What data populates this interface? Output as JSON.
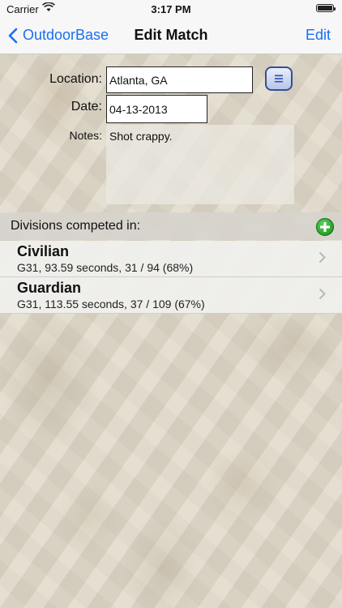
{
  "status": {
    "carrier": "Carrier",
    "time": "3:17 PM",
    "wifi_icon": "wifi-icon",
    "battery_level": 1.0
  },
  "nav": {
    "back_label": "OutdoorBase",
    "title": "Edit Match",
    "edit_label": "Edit"
  },
  "form": {
    "location_label": "Location:",
    "location_value": "Atlanta, GA",
    "date_label": "Date:",
    "date_value": "04-13-2013",
    "notes_label": "Notes:",
    "notes_value": "Shot crappy."
  },
  "divisions": {
    "header": "Divisions competed in:",
    "items": [
      {
        "name": "Civilian",
        "detail": "G31, 93.59 seconds, 31 / 94 (68%)"
      },
      {
        "name": "Guardian",
        "detail": "G31, 113.55 seconds, 37 / 109 (67%)"
      }
    ]
  },
  "colors": {
    "accent": "#1a6ff0",
    "add_button": "#1f9d23"
  }
}
